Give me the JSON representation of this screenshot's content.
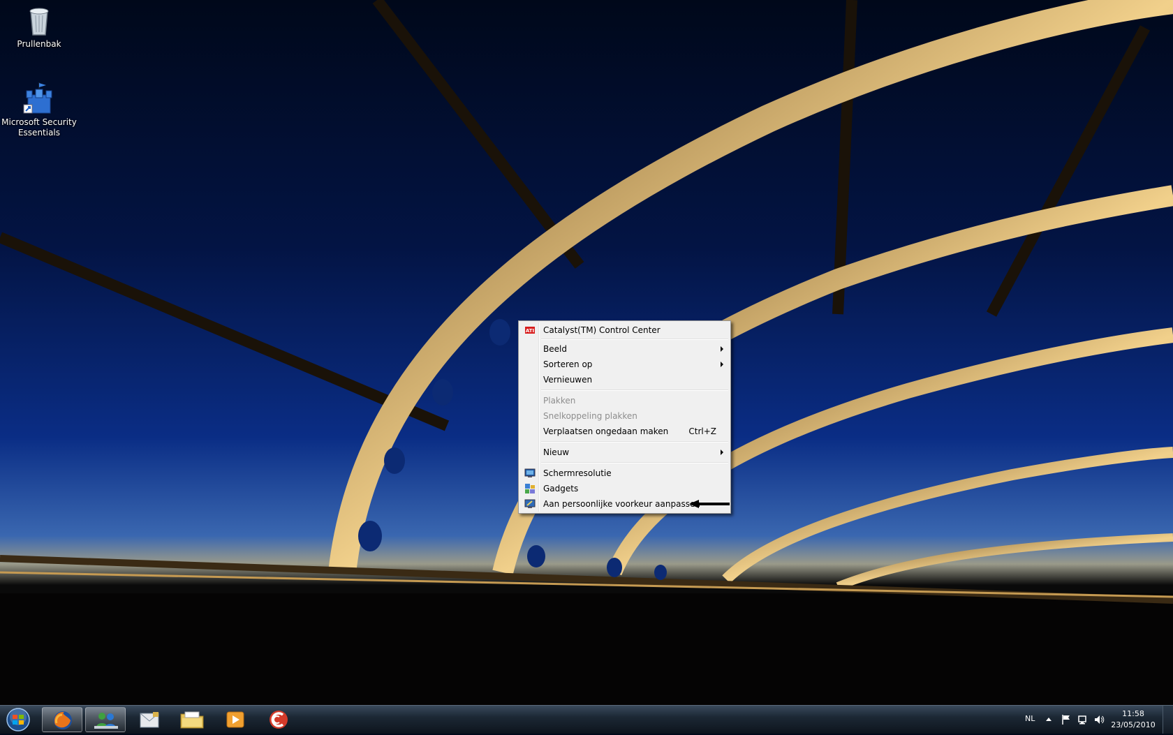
{
  "desktop": {
    "icons": [
      {
        "label": "Prullenbak",
        "icon": "recycle-bin-icon"
      },
      {
        "label": "Microsoft Security Essentials",
        "icon": "security-essentials-icon"
      }
    ]
  },
  "context_menu": {
    "items": [
      {
        "label": "Catalyst(TM) Control Center",
        "icon": "ati-icon",
        "enabled": true
      },
      {
        "label": "Beeld",
        "submenu": true,
        "enabled": true
      },
      {
        "label": "Sorteren op",
        "submenu": true,
        "enabled": true
      },
      {
        "label": "Vernieuwen",
        "enabled": true
      },
      {
        "label": "Plakken",
        "enabled": false
      },
      {
        "label": "Snelkoppeling plakken",
        "enabled": false
      },
      {
        "label": "Verplaatsen ongedaan maken",
        "shortcut": "Ctrl+Z",
        "enabled": true
      },
      {
        "label": "Nieuw",
        "submenu": true,
        "enabled": true
      },
      {
        "label": "Schermresolutie",
        "icon": "display-icon",
        "enabled": true
      },
      {
        "label": "Gadgets",
        "icon": "gadgets-icon",
        "enabled": true
      },
      {
        "label": "Aan persoonlijke voorkeur aanpassen",
        "icon": "personalize-icon",
        "enabled": true
      }
    ],
    "annotation": "arrow pointing at Aan persoonlijke voorkeur aanpassen"
  },
  "taskbar": {
    "pinned": [
      "start-orb-icon",
      "firefox-icon",
      "messenger-icon",
      "mail-icon",
      "explorer-folder-icon",
      "media-player-icon",
      "ccleaner-icon"
    ],
    "active_index": 1,
    "tray": {
      "language": "NL",
      "time": "11:58",
      "date": "23/05/2010"
    }
  },
  "colors": {
    "menu_bg": "#f0f0f0",
    "taskbar_bg": "#1c2835",
    "sky_top": "#000a1a",
    "sky_mid": "#08257a",
    "bridge": "#e8c27a"
  }
}
